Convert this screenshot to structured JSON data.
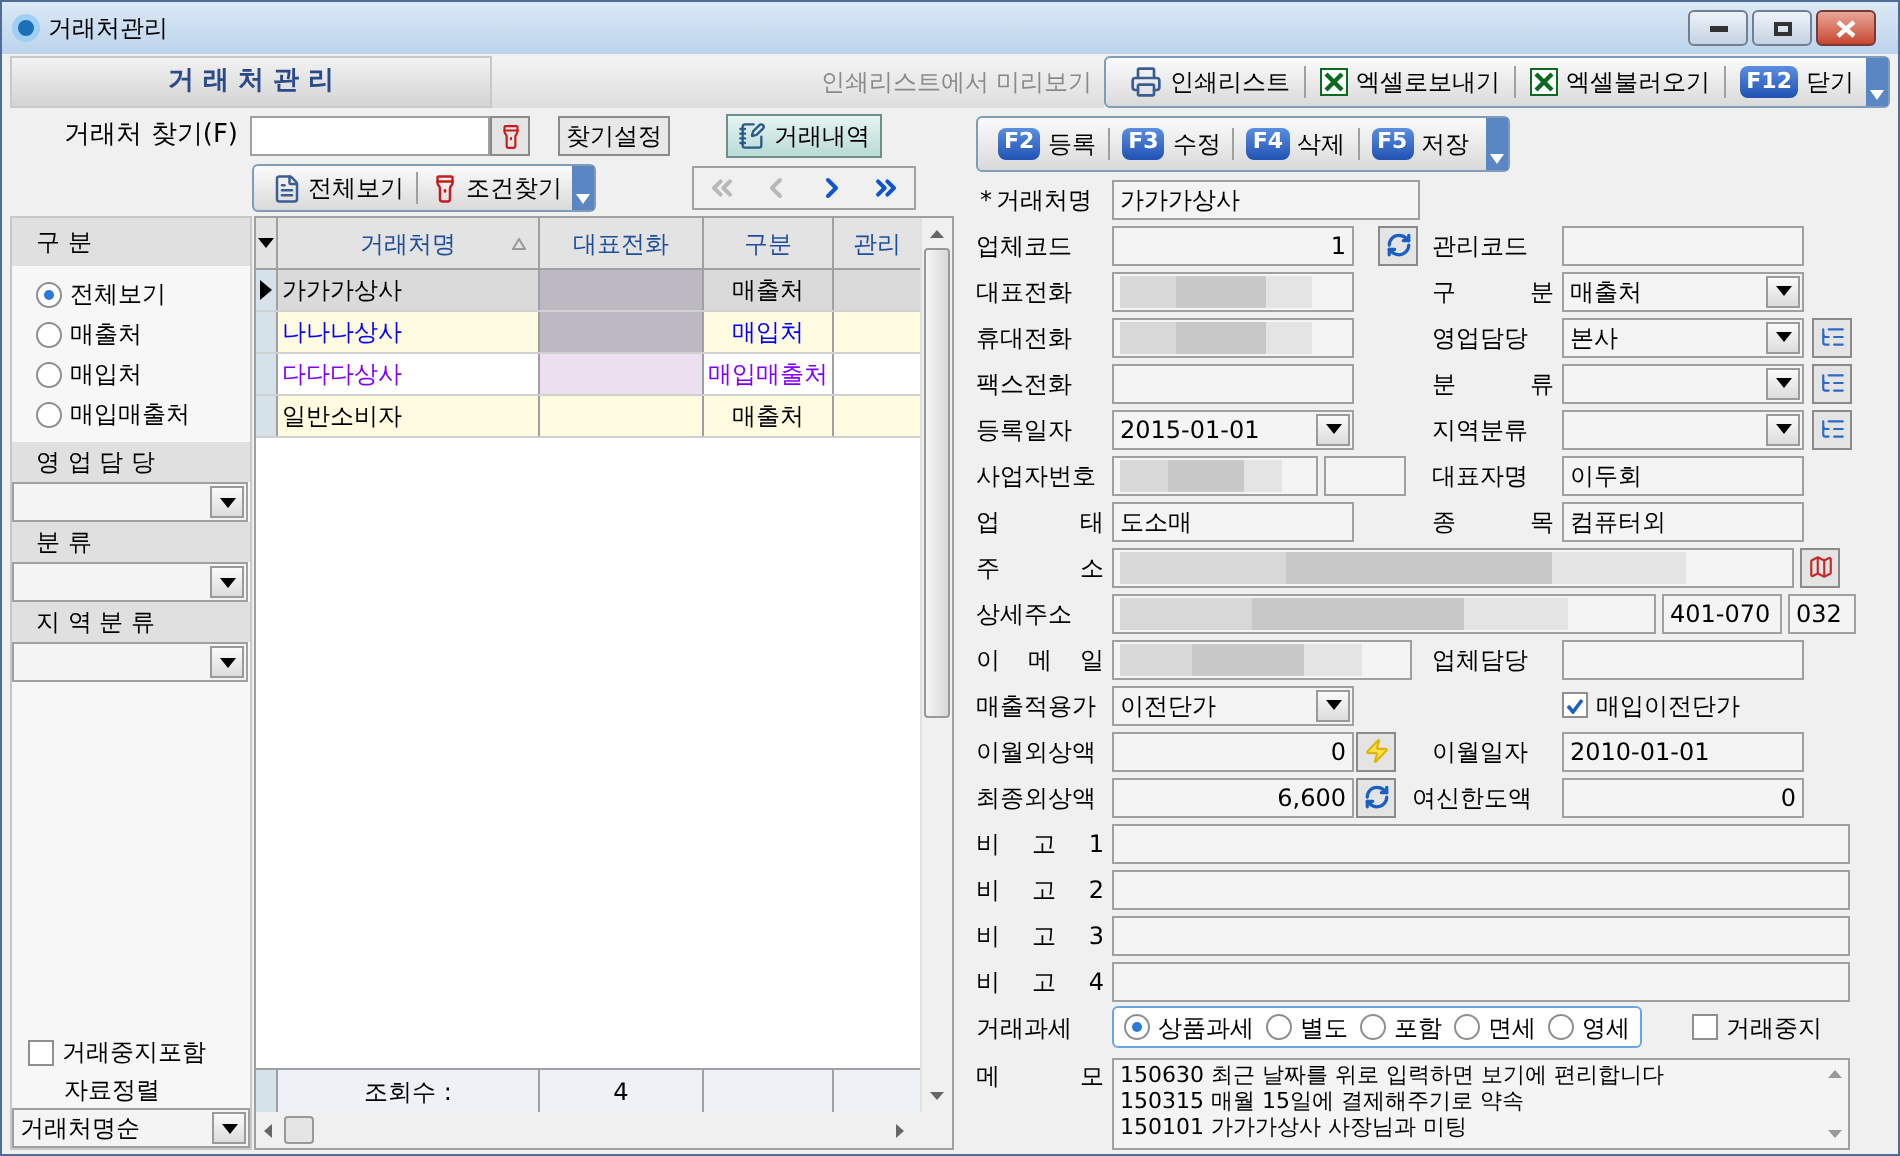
{
  "window": {
    "title": "거래처관리"
  },
  "header": {
    "tab": "거 래 처 관 리",
    "preview_hint": "인쇄리스트에서 미리보기",
    "toolbar": [
      {
        "kind": "printer",
        "label": "인쇄리스트"
      },
      {
        "kind": "excel",
        "label": "엑셀로보내기"
      },
      {
        "kind": "excel",
        "label": "엑셀불러오기"
      },
      {
        "kind": "fkey",
        "key": "F12",
        "label": "닫기"
      }
    ]
  },
  "search": {
    "label": "거래처 찾기(F)",
    "settings_button": "찾기설정",
    "history_button": "거래내역"
  },
  "view_toolbar": [
    {
      "kind": "all",
      "label": "전체보기"
    },
    {
      "kind": "filter",
      "label": "조건찾기"
    }
  ],
  "nav": [
    {
      "kind": "first",
      "disabled": true
    },
    {
      "kind": "prev",
      "disabled": true
    },
    {
      "kind": "next",
      "disabled": false
    },
    {
      "kind": "last",
      "disabled": false
    }
  ],
  "filter": {
    "category": {
      "title": "구 분",
      "options": [
        {
          "label": "전체보기",
          "selected": true
        },
        {
          "label": "매출처",
          "selected": false
        },
        {
          "label": "매입처",
          "selected": false
        },
        {
          "label": "매입매출처",
          "selected": false
        }
      ]
    },
    "sales_rep": {
      "title": "영 업 담 당"
    },
    "class": {
      "title": "분 류"
    },
    "region": {
      "title": "지 역 분 류"
    },
    "include_suspended": {
      "label": "거래중지포함",
      "checked": false
    },
    "sort": {
      "label": "자료정렬",
      "value": "거래처명순"
    }
  },
  "grid": {
    "columns": [
      "거래처명",
      "대표전화",
      "구분",
      "관리"
    ],
    "rows": [
      {
        "name": "가가가상사",
        "phone_redacted": true,
        "category": "매출처",
        "color": "#000000",
        "selected": true
      },
      {
        "name": "나나나상사",
        "phone_redacted": true,
        "category": "매입처",
        "color": "#0000ff",
        "selected": false
      },
      {
        "name": "다다다상사",
        "phone_redacted": true,
        "category": "매입매출처",
        "color": "#8000ff",
        "selected": false
      },
      {
        "name": "일반소비자",
        "phone_redacted": false,
        "category": "매출처",
        "color": "#000000",
        "selected": false
      }
    ],
    "footer": {
      "label": "조회수 :",
      "count": "4"
    }
  },
  "actions": [
    {
      "key": "F2",
      "label": "등록"
    },
    {
      "key": "F3",
      "label": "수정"
    },
    {
      "key": "F4",
      "label": "삭제"
    },
    {
      "key": "F5",
      "label": "저장"
    }
  ],
  "detail": {
    "name": {
      "mark": "*",
      "label": "거래처명",
      "value": "가가가상사"
    },
    "code": {
      "label": "업체코드",
      "value": "1"
    },
    "manage_code": {
      "label": "관리코드"
    },
    "phone": {
      "label": "대표전화",
      "redacted": true
    },
    "category": {
      "label": "구 분",
      "value": "매출처"
    },
    "mobile": {
      "label": "휴대전화",
      "redacted": true
    },
    "sales_rep": {
      "label": "영업담당",
      "value": "본사"
    },
    "fax": {
      "label": "팩스전화"
    },
    "class": {
      "label": "분 류"
    },
    "reg_date": {
      "label": "등록일자",
      "value": "2015-01-01"
    },
    "region": {
      "label": "지역분류"
    },
    "biz_no": {
      "label": "사업자번호",
      "redacted": true
    },
    "ceo": {
      "label": "대표자명",
      "value": "이두회"
    },
    "biz_type": {
      "label": "업 태",
      "value": "도소매"
    },
    "biz_item": {
      "label": "종 목",
      "value": "컴퓨터외"
    },
    "address": {
      "label": "주 소",
      "redacted": true
    },
    "address_detail": {
      "label": "상세주소",
      "redacted": true
    },
    "zip": {
      "value": "401-070"
    },
    "area_code": {
      "value": "032"
    },
    "email": {
      "label": "이 메 일",
      "redacted": true
    },
    "contact": {
      "label": "업체담당"
    },
    "price_mode": {
      "label": "매출적용가",
      "value": "이전단가"
    },
    "purchase_prev_price": {
      "label": "매입이전단가",
      "checked": true
    },
    "carry_balance": {
      "label": "이월외상액",
      "value": "0"
    },
    "carry_date": {
      "label": "이월일자",
      "value": "2010-01-01"
    },
    "final_balance": {
      "label": "최종외상액",
      "value": "6,600"
    },
    "credit_limit": {
      "label": "여신한도액",
      "value": "0"
    },
    "notes": [
      {
        "label": "비 고 1"
      },
      {
        "label": "비 고 2"
      },
      {
        "label": "비 고 3"
      },
      {
        "label": "비 고 4"
      }
    ],
    "tax": {
      "label": "거래과세",
      "options": [
        {
          "label": "상품과세",
          "selected": true
        },
        {
          "label": "별도",
          "selected": false
        },
        {
          "label": "포함",
          "selected": false
        },
        {
          "label": "면세",
          "selected": false
        },
        {
          "label": "영세",
          "selected": false
        }
      ]
    },
    "suspended": {
      "label": "거래중지",
      "checked": false
    },
    "memo": {
      "label": "메 모",
      "lines": [
        "150630 최근 날짜를 위로 입력하면 보기에 편리합니다",
        "150315 매월 15일에 결제해주기로 약속",
        "150101 가가가상사 사장님과 미팅"
      ]
    }
  }
}
